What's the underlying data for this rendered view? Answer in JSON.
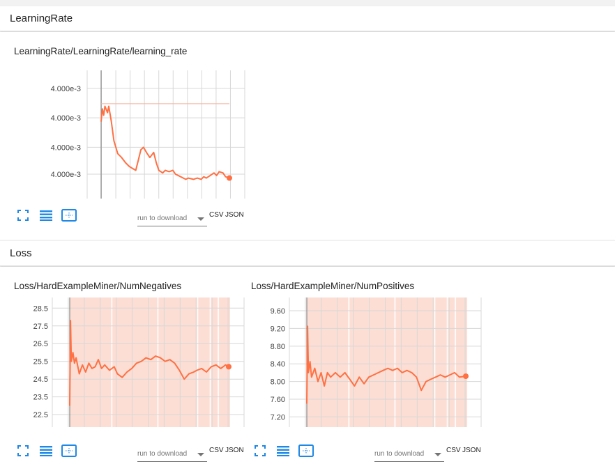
{
  "sections": [
    {
      "title": "LearningRate",
      "cards": [
        {
          "title": "LearningRate/LearningRate/learning_rate",
          "run_select_placeholder": "run to download",
          "csv_label": "CSV",
          "json_label": "JSON",
          "icons": [
            "expand-icon",
            "list-icon",
            "fit-domain-icon"
          ]
        }
      ]
    },
    {
      "title": "Loss",
      "cards": [
        {
          "title": "Loss/HardExampleMiner/NumNegatives",
          "run_select_placeholder": "run to download",
          "csv_label": "CSV",
          "json_label": "JSON",
          "icons": [
            "expand-icon",
            "list-icon",
            "fit-domain-icon"
          ]
        },
        {
          "title": "Loss/HardExampleMiner/NumPositives",
          "run_select_placeholder": "run to download",
          "csv_label": "CSV",
          "json_label": "JSON",
          "icons": [
            "expand-icon",
            "list-icon",
            "fit-domain-icon"
          ]
        }
      ]
    }
  ],
  "colors": {
    "series": "#ff7043",
    "series_light": "#f7b19d",
    "band": "#fbd3c6",
    "grid": "#d7d7d7",
    "icon": "#1e88e5"
  },
  "chart_data": [
    {
      "type": "line",
      "title": "LearningRate/LearningRate/learning_rate",
      "ytick_labels": [
        "4.000e-3",
        "4.000e-3",
        "4.000e-3",
        "4.000e-3"
      ],
      "ylim": [
        0,
        1
      ],
      "y_ticks": [
        0.86,
        0.63,
        0.4,
        0.19
      ],
      "xlim": [
        0,
        1
      ],
      "grid": true,
      "reference_line": 0.74,
      "series": [
        {
          "x": [
            0.0,
            0.01,
            0.02,
            0.03,
            0.05,
            0.06,
            0.08,
            0.1,
            0.13,
            0.16,
            0.19,
            0.22,
            0.27,
            0.29,
            0.31,
            0.33,
            0.36,
            0.38,
            0.41,
            0.43,
            0.45,
            0.48,
            0.5,
            0.53,
            0.56,
            0.58,
            0.62,
            0.66,
            0.68,
            0.72,
            0.75,
            0.78,
            0.8,
            0.82,
            0.85,
            0.88,
            0.9,
            0.92,
            0.95,
            0.97,
            1.0
          ],
          "y": [
            0.6,
            0.7,
            0.65,
            0.72,
            0.67,
            0.72,
            0.6,
            0.45,
            0.35,
            0.32,
            0.28,
            0.25,
            0.22,
            0.3,
            0.38,
            0.4,
            0.35,
            0.32,
            0.36,
            0.28,
            0.22,
            0.2,
            0.22,
            0.21,
            0.22,
            0.19,
            0.17,
            0.15,
            0.16,
            0.15,
            0.16,
            0.15,
            0.17,
            0.16,
            0.18,
            0.2,
            0.18,
            0.21,
            0.2,
            0.17,
            0.16
          ]
        }
      ]
    },
    {
      "type": "line",
      "title": "Loss/HardExampleMiner/NumNegatives",
      "ytick_labels": [
        "28.5",
        "27.5",
        "26.5",
        "25.5",
        "24.5",
        "23.5",
        "22.5"
      ],
      "y_ticks": [
        28.5,
        27.5,
        26.5,
        25.5,
        24.5,
        23.5,
        22.5
      ],
      "ylim": [
        21.8,
        29.1
      ],
      "xlim": [
        0,
        1
      ],
      "grid": true,
      "series": [
        {
          "x": [
            0.0,
            0.005,
            0.01,
            0.02,
            0.03,
            0.04,
            0.06,
            0.08,
            0.1,
            0.12,
            0.14,
            0.16,
            0.18,
            0.2,
            0.22,
            0.25,
            0.28,
            0.3,
            0.33,
            0.36,
            0.39,
            0.42,
            0.45,
            0.48,
            0.51,
            0.54,
            0.57,
            0.6,
            0.63,
            0.66,
            0.69,
            0.72,
            0.75,
            0.78,
            0.8,
            0.83,
            0.86,
            0.89,
            0.92,
            0.95,
            0.98,
            1.0
          ],
          "y": [
            23.0,
            27.8,
            25.5,
            26.0,
            25.4,
            25.7,
            24.8,
            25.3,
            24.9,
            25.4,
            25.1,
            25.2,
            25.6,
            25.1,
            25.3,
            25.0,
            25.2,
            24.8,
            24.6,
            24.9,
            25.1,
            25.4,
            25.5,
            25.7,
            25.6,
            25.8,
            25.7,
            25.5,
            25.6,
            25.4,
            25.0,
            24.5,
            24.8,
            24.9,
            25.0,
            25.1,
            24.9,
            25.2,
            25.3,
            25.1,
            25.3,
            25.2
          ]
        }
      ]
    },
    {
      "type": "line",
      "title": "Loss/HardExampleMiner/NumPositives",
      "ytick_labels": [
        "9.60",
        "9.20",
        "8.80",
        "8.40",
        "8.00",
        "7.60",
        "7.20"
      ],
      "y_ticks": [
        9.6,
        9.2,
        8.8,
        8.4,
        8.0,
        7.6,
        7.2
      ],
      "ylim": [
        6.97,
        9.9
      ],
      "xlim": [
        0,
        1
      ],
      "grid": true,
      "series": [
        {
          "x": [
            0.0,
            0.005,
            0.01,
            0.02,
            0.03,
            0.05,
            0.07,
            0.09,
            0.11,
            0.13,
            0.15,
            0.18,
            0.21,
            0.24,
            0.27,
            0.3,
            0.33,
            0.36,
            0.39,
            0.42,
            0.45,
            0.48,
            0.51,
            0.54,
            0.57,
            0.6,
            0.63,
            0.66,
            0.69,
            0.72,
            0.75,
            0.78,
            0.81,
            0.84,
            0.87,
            0.9,
            0.93,
            0.96,
            1.0
          ],
          "y": [
            7.5,
            9.25,
            8.2,
            8.45,
            8.1,
            8.3,
            8.0,
            8.2,
            7.9,
            8.2,
            8.1,
            8.2,
            8.1,
            8.2,
            8.05,
            7.9,
            8.1,
            7.95,
            8.1,
            8.15,
            8.2,
            8.25,
            8.3,
            8.25,
            8.3,
            8.2,
            8.25,
            8.2,
            8.1,
            7.8,
            8.0,
            8.05,
            8.1,
            8.15,
            8.1,
            8.15,
            8.2,
            8.1,
            8.12
          ]
        }
      ]
    }
  ]
}
